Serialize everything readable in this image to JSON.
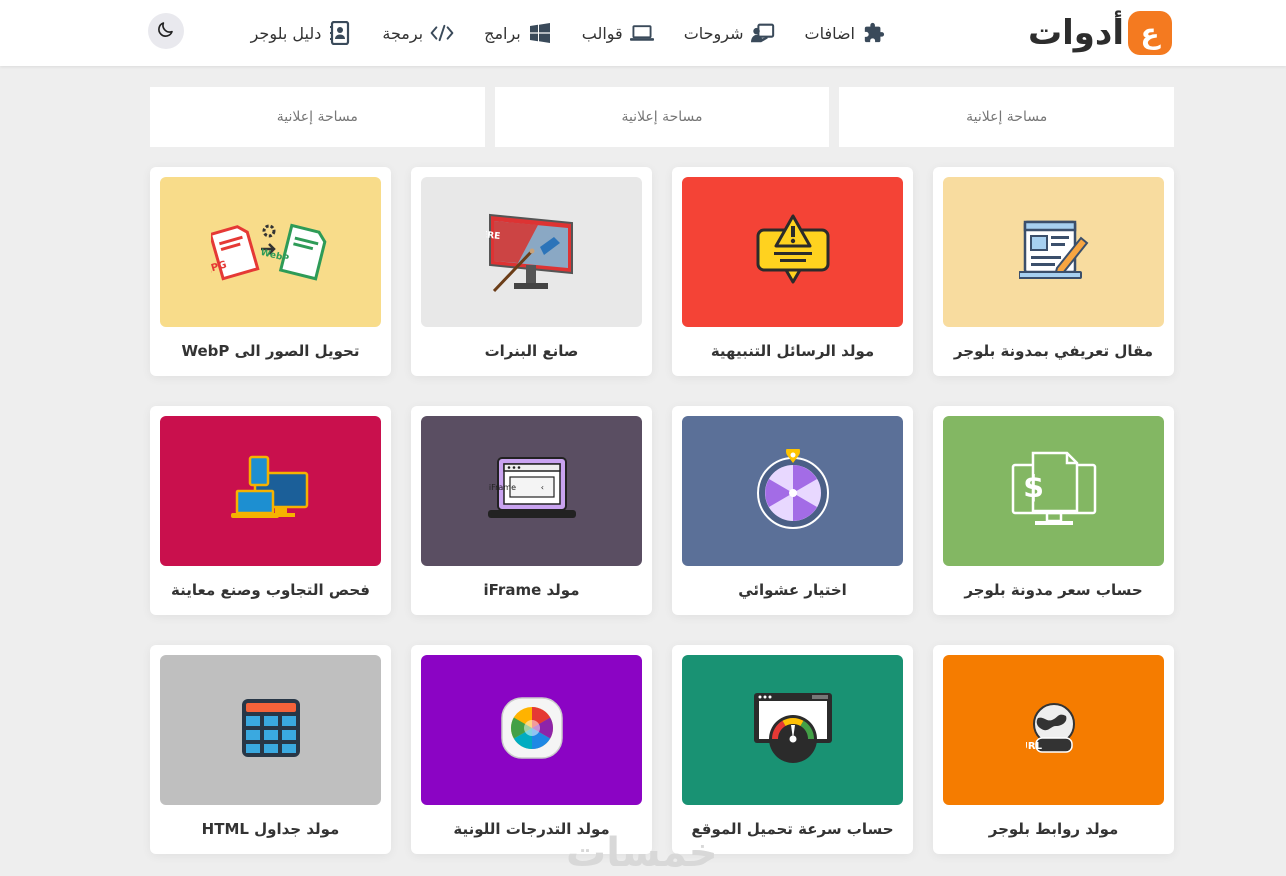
{
  "header": {
    "logo_text": "أدوات",
    "nav": [
      {
        "label": "اضافات",
        "icon": "puzzle-icon"
      },
      {
        "label": "شروحات",
        "icon": "teacher-icon"
      },
      {
        "label": "قوالب",
        "icon": "laptop-icon"
      },
      {
        "label": "برامج",
        "icon": "windows-icon"
      },
      {
        "label": "برمجة",
        "icon": "code-icon"
      },
      {
        "label": "دليل بلوجر",
        "icon": "contact-book-icon"
      }
    ],
    "theme_toggle_icon": "moon-icon"
  },
  "ads": [
    {
      "label": "مساحة إعلانية"
    },
    {
      "label": "مساحة إعلانية"
    },
    {
      "label": "مساحة إعلانية"
    }
  ],
  "tools": [
    {
      "title": "مقال تعريفي بمدونة بلوجر",
      "icon": "article-edit-icon",
      "color": "#f8dc9f"
    },
    {
      "title": "مولد الرسائل التنبيهية",
      "icon": "alert-message-icon",
      "color": "#f44336"
    },
    {
      "title": "صانع البنرات",
      "icon": "billboard-icon",
      "color": "#e8e8e8"
    },
    {
      "title": "تحويل الصور الى WebP",
      "icon": "jpg-to-webp-icon",
      "color": "#f8dc8a"
    },
    {
      "title": "حساب سعر مدونة بلوجر",
      "icon": "dollar-monitor-icon",
      "color": "#83b763"
    },
    {
      "title": "اختيار عشوائي",
      "icon": "spin-wheel-icon",
      "color": "#5b7098"
    },
    {
      "title": "مولد iFrame",
      "icon": "iframe-laptop-icon",
      "color": "#5a4e62"
    },
    {
      "title": "فحص التجاوب وصنع معاينة",
      "icon": "responsive-devices-icon",
      "color": "#c9104d"
    },
    {
      "title": "مولد روابط بلوجر",
      "icon": "url-globe-icon",
      "color": "#f57c00"
    },
    {
      "title": "حساب سرعة تحميل الموقع",
      "icon": "speedometer-icon",
      "color": "#199273"
    },
    {
      "title": "مولد التدرجات اللونية",
      "icon": "color-wheel-icon",
      "color": "#8b04c4"
    },
    {
      "title": "مولد جداول HTML",
      "icon": "table-icon",
      "color": "#bfbfbf"
    }
  ],
  "watermark": "خمسات"
}
